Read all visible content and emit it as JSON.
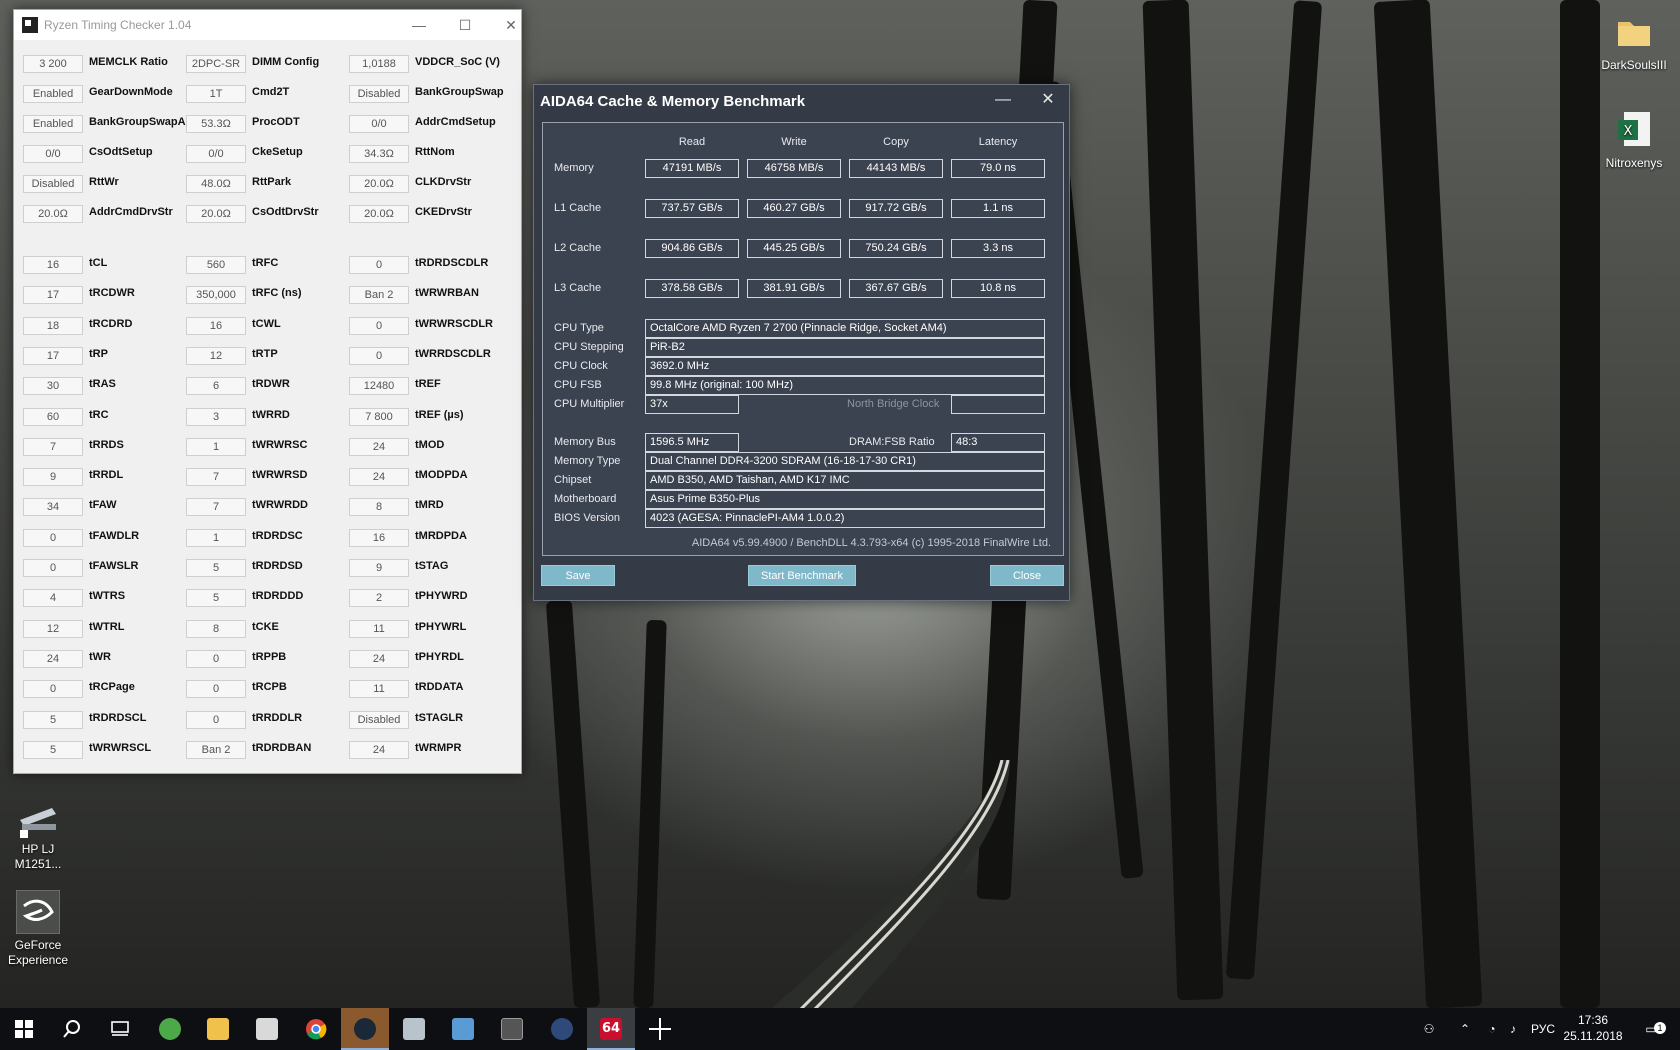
{
  "desktop": {
    "icons": [
      {
        "label": "DarkSoulsIII",
        "icon": "folder-icon"
      },
      {
        "label": "Nitroxenys",
        "icon": "excel-file-icon"
      },
      {
        "label": "HP LJ M1251...",
        "icon": "scanner-icon"
      },
      {
        "label": "GeForce Experience",
        "icon": "geforce-icon"
      }
    ]
  },
  "rtc": {
    "title": "Ryzen Timing Checker 1.04",
    "rows": [
      [
        {
          "v": "3 200",
          "l": "MEMCLK Ratio"
        },
        {
          "v": "2DPC-SR",
          "l": "DIMM Config"
        },
        {
          "v": "1,0188",
          "l": "VDDCR_SoC (V)"
        }
      ],
      [
        {
          "v": "Enabled",
          "l": "GearDownMode"
        },
        {
          "v": "1T",
          "l": "Cmd2T"
        },
        {
          "v": "Disabled",
          "l": "BankGroupSwap"
        }
      ],
      [
        {
          "v": "Enabled",
          "l": "BankGroupSwapAlt"
        },
        {
          "v": "53.3Ω",
          "l": "ProcODT"
        },
        {
          "v": "0/0",
          "l": "AddrCmdSetup"
        }
      ],
      [
        {
          "v": "0/0",
          "l": "CsOdtSetup"
        },
        {
          "v": "0/0",
          "l": "CkeSetup"
        },
        {
          "v": "34.3Ω",
          "l": "RttNom"
        }
      ],
      [
        {
          "v": "Disabled",
          "l": "RttWr"
        },
        {
          "v": "48.0Ω",
          "l": "RttPark"
        },
        {
          "v": "20.0Ω",
          "l": "CLKDrvStr"
        }
      ],
      [
        {
          "v": "20.0Ω",
          "l": "AddrCmdDrvStr"
        },
        {
          "v": "20.0Ω",
          "l": "CsOdtDrvStr"
        },
        {
          "v": "20.0Ω",
          "l": "CKEDrvStr"
        }
      ],
      [
        {
          "v": "16",
          "l": "tCL"
        },
        {
          "v": "560",
          "l": "tRFC"
        },
        {
          "v": "0",
          "l": "tRDRDSCDLR"
        }
      ],
      [
        {
          "v": "17",
          "l": "tRCDWR"
        },
        {
          "v": "350,000",
          "l": "tRFC (ns)"
        },
        {
          "v": "Ban 2",
          "l": "tWRWRBAN"
        }
      ],
      [
        {
          "v": "18",
          "l": "tRCDRD"
        },
        {
          "v": "16",
          "l": "tCWL"
        },
        {
          "v": "0",
          "l": "tWRWRSCDLR"
        }
      ],
      [
        {
          "v": "17",
          "l": "tRP"
        },
        {
          "v": "12",
          "l": "tRTP"
        },
        {
          "v": "0",
          "l": "tWRRDSCDLR"
        }
      ],
      [
        {
          "v": "30",
          "l": "tRAS"
        },
        {
          "v": "6",
          "l": "tRDWR"
        },
        {
          "v": "12480",
          "l": "tREF"
        }
      ],
      [
        {
          "v": "60",
          "l": "tRC"
        },
        {
          "v": "3",
          "l": "tWRRD"
        },
        {
          "v": "7 800",
          "l": "tREF (µs)"
        }
      ],
      [
        {
          "v": "7",
          "l": "tRRDS"
        },
        {
          "v": "1",
          "l": "tWRWRSC"
        },
        {
          "v": "24",
          "l": "tMOD"
        }
      ],
      [
        {
          "v": "9",
          "l": "tRRDL"
        },
        {
          "v": "7",
          "l": "tWRWRSD"
        },
        {
          "v": "24",
          "l": "tMODPDA"
        }
      ],
      [
        {
          "v": "34",
          "l": "tFAW"
        },
        {
          "v": "7",
          "l": "tWRWRDD"
        },
        {
          "v": "8",
          "l": "tMRD"
        }
      ],
      [
        {
          "v": "0",
          "l": "tFAWDLR"
        },
        {
          "v": "1",
          "l": "tRDRDSC"
        },
        {
          "v": "16",
          "l": "tMRDPDA"
        }
      ],
      [
        {
          "v": "0",
          "l": "tFAWSLR"
        },
        {
          "v": "5",
          "l": "tRDRDSD"
        },
        {
          "v": "9",
          "l": "tSTAG"
        }
      ],
      [
        {
          "v": "4",
          "l": "tWTRS"
        },
        {
          "v": "5",
          "l": "tRDRDDD"
        },
        {
          "v": "2",
          "l": "tPHYWRD"
        }
      ],
      [
        {
          "v": "12",
          "l": "tWTRL"
        },
        {
          "v": "8",
          "l": "tCKE"
        },
        {
          "v": "11",
          "l": "tPHYWRL"
        }
      ],
      [
        {
          "v": "24",
          "l": "tWR"
        },
        {
          "v": "0",
          "l": "tRPPB"
        },
        {
          "v": "24",
          "l": "tPHYRDL"
        }
      ],
      [
        {
          "v": "0",
          "l": "tRCPage"
        },
        {
          "v": "0",
          "l": "tRCPB"
        },
        {
          "v": "11",
          "l": "tRDDATA"
        }
      ],
      [
        {
          "v": "5",
          "l": "tRDRDSCL"
        },
        {
          "v": "0",
          "l": "tRRDDLR"
        },
        {
          "v": "Disabled",
          "l": "tSTAGLR"
        }
      ],
      [
        {
          "v": "5",
          "l": "tWRWRSCL"
        },
        {
          "v": "Ban 2",
          "l": "tRDRDBAN"
        },
        {
          "v": "24",
          "l": "tWRMPR"
        }
      ]
    ]
  },
  "aida": {
    "title": "AIDA64 Cache & Memory Benchmark",
    "columns": [
      "Read",
      "Write",
      "Copy",
      "Latency"
    ],
    "bench": [
      {
        "label": "Memory",
        "values": [
          "47191 MB/s",
          "46758 MB/s",
          "44143 MB/s",
          "79.0 ns"
        ]
      },
      {
        "label": "L1 Cache",
        "values": [
          "737.57 GB/s",
          "460.27 GB/s",
          "917.72 GB/s",
          "1.1 ns"
        ]
      },
      {
        "label": "L2 Cache",
        "values": [
          "904.86 GB/s",
          "445.25 GB/s",
          "750.24 GB/s",
          "3.3 ns"
        ]
      },
      {
        "label": "L3 Cache",
        "values": [
          "378.58 GB/s",
          "381.91 GB/s",
          "367.67 GB/s",
          "10.8 ns"
        ]
      }
    ],
    "cpu_type_label": "CPU Type",
    "cpu_type": "OctalCore AMD Ryzen 7 2700  (Pinnacle Ridge, Socket AM4)",
    "cpu_stepping_label": "CPU Stepping",
    "cpu_stepping": "PiR-B2",
    "cpu_clock_label": "CPU Clock",
    "cpu_clock": "3692.0 MHz",
    "cpu_fsb_label": "CPU FSB",
    "cpu_fsb": "99.8 MHz  (original: 100 MHz)",
    "cpu_mult_label": "CPU Multiplier",
    "cpu_mult": "37x",
    "nb_clock_label": "North Bridge Clock",
    "nb_clock": "",
    "mem_bus_label": "Memory Bus",
    "mem_bus": "1596.5 MHz",
    "dram_fsb_label": "DRAM:FSB Ratio",
    "dram_fsb": "48:3",
    "mem_type_label": "Memory Type",
    "mem_type": "Dual Channel DDR4-3200 SDRAM  (16-18-17-30 CR1)",
    "chipset_label": "Chipset",
    "chipset": "AMD B350, AMD Taishan, AMD K17 IMC",
    "mobo_label": "Motherboard",
    "mobo": "Asus Prime B350-Plus",
    "bios_label": "BIOS Version",
    "bios": "4023  (AGESA: PinnaclePI-AM4 1.0.0.2)",
    "footer": "AIDA64 v5.99.4900 / BenchDLL 4.3.793-x64  (c) 1995-2018 FinalWire Ltd.",
    "save_label": "Save",
    "start_label": "Start Benchmark",
    "close_label": "Close"
  },
  "taskbar": {
    "lang": "РУС",
    "time": "17:36",
    "date": "25.11.2018",
    "notif_count": "1",
    "active_app": "64",
    "apps": [
      "start-icon",
      "search-icon",
      "task-view-icon",
      "app-icon",
      "file-explorer-icon",
      "calculator-icon",
      "chrome-icon",
      "steam-icon",
      "app-icon",
      "app-icon",
      "geforce-icon",
      "app-icon",
      "aida64-icon",
      "crosshair-icon"
    ]
  }
}
